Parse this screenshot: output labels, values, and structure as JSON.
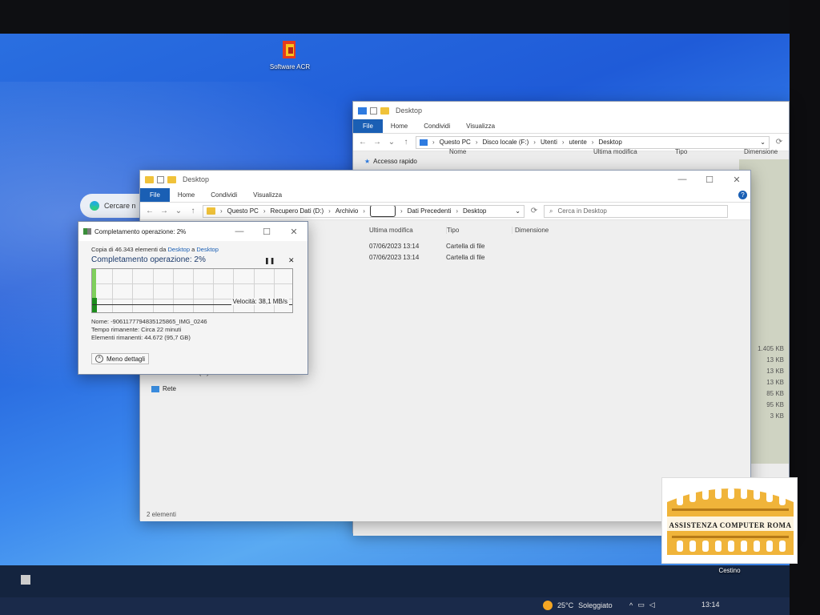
{
  "desktop": {
    "icon_software": "Software ACR",
    "icon_cestino": "Cestino"
  },
  "edge_search": {
    "placeholder": "Cercare n"
  },
  "back_window": {
    "title": "Desktop",
    "ribbon": [
      "File",
      "Home",
      "Condividi",
      "Visualizza"
    ],
    "breadcrumb": [
      "Questo PC",
      "Disco locale (F:)",
      "Utenti",
      "utente",
      "Desktop"
    ],
    "nav_accesso_rapido": "Accesso rapido",
    "columns": [
      "Nome",
      "Ultima modifica",
      "Tipo",
      "Dimensione"
    ],
    "sizes": [
      "1.405 KB",
      "13 KB",
      "13 KB",
      "13 KB",
      "85 KB",
      "95 KB",
      "3 KB"
    ]
  },
  "front_window": {
    "title": "Desktop",
    "ribbon": [
      "File",
      "Home",
      "Condividi",
      "Visualizza"
    ],
    "breadcrumb": [
      "Questo PC",
      "Recupero Dati (D:)",
      "Archivio",
      "Dati Precedenti",
      "Desktop"
    ],
    "search_placeholder": "Cerca in Desktop",
    "columns": [
      "Ultima modifica",
      "Tipo",
      "Dimensione"
    ],
    "rows": [
      {
        "date": "07/06/2023 13:14",
        "type": "Cartella di file"
      },
      {
        "date": "07/06/2023 13:14",
        "type": "Cartella di file"
      }
    ],
    "nav_disco_locale": "Disco locale (F:)",
    "nav_rete": "Rete",
    "status": "2 elementi"
  },
  "copy_dialog": {
    "title": "Completamento operazione: 2%",
    "copy_prefix": "Copia di 46.343 elementi da",
    "source": "Desktop",
    "connector": "a",
    "destination": "Desktop",
    "heading": "Completamento operazione: 2%",
    "progress_percent": 2,
    "speed": "Velocità: 38,1 MB/s",
    "name_line": "Nome: -9061177794835125865_IMG_0246",
    "time_line": "Tempo rimanente: Circa 22 minuti",
    "items_line": "Elementi rimanenti: 44.672 (95,7 GB)",
    "less_details": "Meno dettagli"
  },
  "taskbar": {
    "weather": "25°C",
    "weather_desc": "Soleggiato",
    "time": "13:14"
  },
  "watermark": {
    "text": "ASSISTENZA COMPUTER ROMA"
  },
  "colors": {
    "accent": "#1a5fb4",
    "progress": "#7fcf5c",
    "folder": "#f0c23a"
  }
}
